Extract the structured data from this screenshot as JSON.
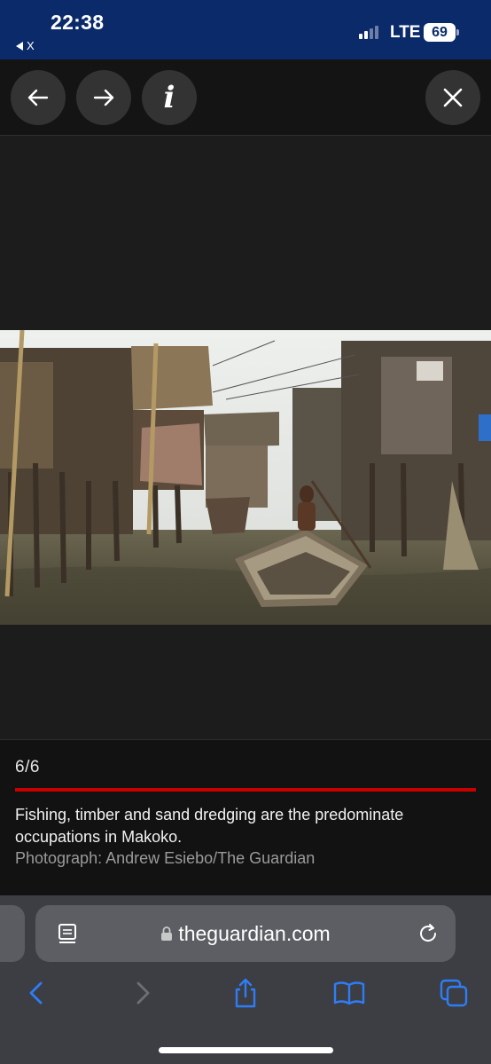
{
  "status_bar": {
    "time": "22:38",
    "back_app": "X",
    "network": "LTE",
    "battery": "69"
  },
  "gallery": {
    "buttons": {
      "previous_icon": "arrow-left-icon",
      "next_icon": "arrow-right-icon",
      "info_icon": "info-icon",
      "info_glyph": "i",
      "close_icon": "close-icon"
    },
    "counter": "6/6",
    "progress_fraction": 1.0,
    "caption": "Fishing, timber and sand dredging are the predominate occupations in Makoko.",
    "credit": "Photograph: Andrew Esiebo/The Guardian",
    "accent_color": "#c70000"
  },
  "safari": {
    "url": "theguardian.com",
    "toolbar": {
      "back_icon": "chevron-left-icon",
      "forward_icon": "chevron-right-icon",
      "share_icon": "share-icon",
      "bookmarks_icon": "book-icon",
      "tabs_icon": "tabs-icon"
    }
  }
}
